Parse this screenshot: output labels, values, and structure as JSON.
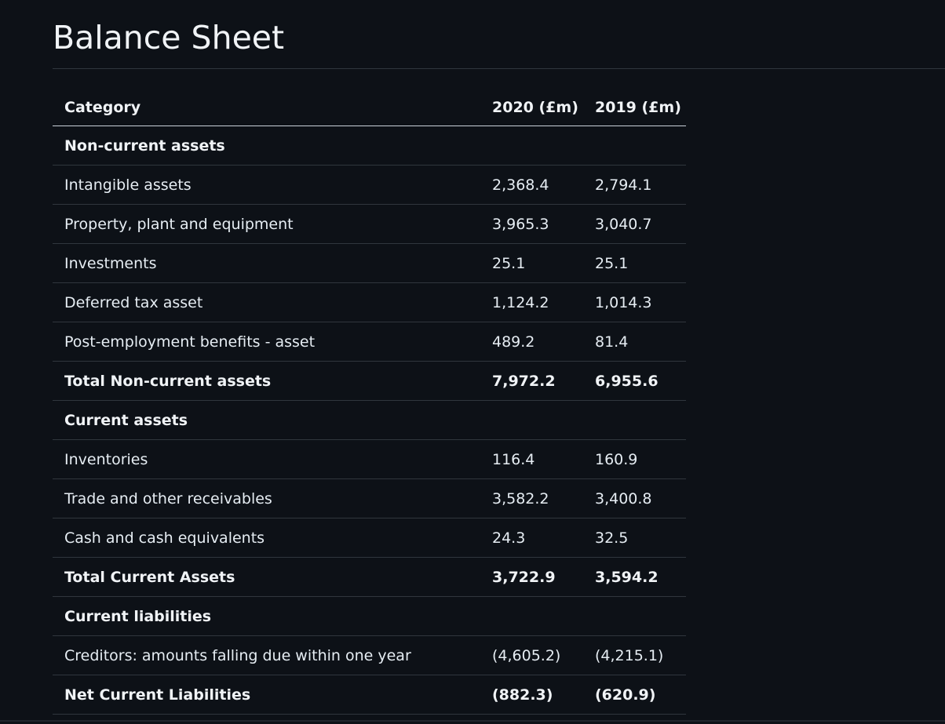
{
  "page": {
    "title": "Balance Sheet"
  },
  "table": {
    "headers": [
      "Category",
      "2020 (£m)",
      "2019 (£m)"
    ],
    "rows": [
      {
        "label": "Non-current assets",
        "y2020": "",
        "y2019": ""
      },
      {
        "label": "Intangible assets",
        "y2020": "2,368.4",
        "y2019": "2,794.1"
      },
      {
        "label": "Property, plant and equipment",
        "y2020": "3,965.3",
        "y2019": "3,040.7"
      },
      {
        "label": "Investments",
        "y2020": "25.1",
        "y2019": "25.1"
      },
      {
        "label": "Deferred tax asset",
        "y2020": "1,124.2",
        "y2019": "1,014.3"
      },
      {
        "label": "Post-employment benefits - asset",
        "y2020": "489.2",
        "y2019": "81.4"
      },
      {
        "label": "Total Non-current assets",
        "y2020": "7,972.2",
        "y2019": "6,955.6"
      },
      {
        "label": "Current assets",
        "y2020": "",
        "y2019": ""
      },
      {
        "label": "Inventories",
        "y2020": "116.4",
        "y2019": "160.9"
      },
      {
        "label": "Trade and other receivables",
        "y2020": "3,582.2",
        "y2019": "3,400.8"
      },
      {
        "label": "Cash and cash equivalents",
        "y2020": "24.3",
        "y2019": "32.5"
      },
      {
        "label": "Total Current Assets",
        "y2020": "3,722.9",
        "y2019": "3,594.2"
      },
      {
        "label": "Current liabilities",
        "y2020": "",
        "y2019": ""
      },
      {
        "label": "Creditors: amounts falling due within one year",
        "y2020": "(4,605.2)",
        "y2019": "(4,215.1)"
      },
      {
        "label": "Net Current Liabilities",
        "y2020": "(882.3)",
        "y2019": "(620.9)"
      }
    ]
  }
}
